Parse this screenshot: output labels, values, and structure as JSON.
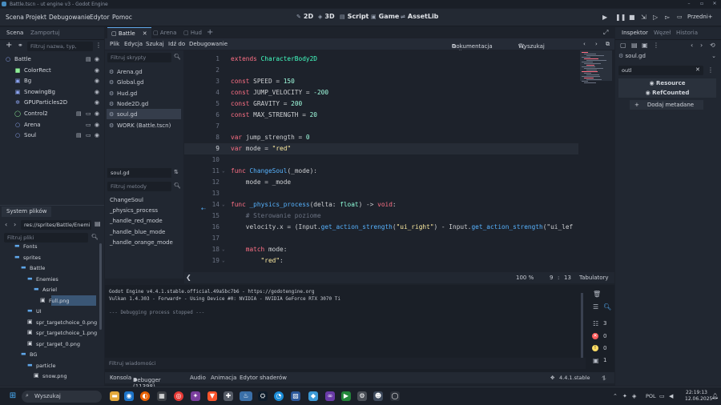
{
  "window": {
    "title": "Battle.tscn - ut engine v3 - Godot Engine"
  },
  "menubar": {
    "items": [
      "Scena",
      "Projekt",
      "Debugowanie",
      "Edytor",
      "Pomoc"
    ],
    "workspaces": [
      "2D",
      "3D",
      "Script",
      "Game",
      "AssetLib"
    ],
    "renderer": "Przedni+"
  },
  "scene_dock": {
    "tabs": [
      "Scena",
      "Zamportuj"
    ],
    "filter_placeholder": "Filtruj nazwa, typ,",
    "nodes": [
      {
        "label": "Battle",
        "icon": "node2d-icon",
        "color": "#8da5f3",
        "indent": 0
      },
      {
        "label": "ColorRect",
        "icon": "colorrect-icon",
        "color": "#8eef97",
        "indent": 1
      },
      {
        "label": "Bg",
        "icon": "sprite-icon",
        "color": "#8da5f3",
        "indent": 1
      },
      {
        "label": "SnowingBg",
        "icon": "sprite-icon",
        "color": "#8da5f3",
        "indent": 1
      },
      {
        "label": "GPUParticles2D",
        "icon": "particles-icon",
        "color": "#8da5f3",
        "indent": 1
      },
      {
        "label": "Control2",
        "icon": "control-icon",
        "color": "#8eef97",
        "indent": 1
      },
      {
        "label": "Arena",
        "icon": "node2d-icon",
        "color": "#8da5f3",
        "indent": 1
      },
      {
        "label": "Soul",
        "icon": "node2d-icon",
        "color": "#8da5f3",
        "indent": 1
      }
    ]
  },
  "filesystem": {
    "tab": "System plików",
    "path": "res://sprites/Battle/Enemi",
    "filter_placeholder": "Filtruj pliki",
    "rows": [
      {
        "label": "Fonts",
        "type": "folder",
        "indent": 1
      },
      {
        "label": "sprites",
        "type": "folder",
        "indent": 1
      },
      {
        "label": "Battle",
        "type": "folder",
        "indent": 2
      },
      {
        "label": "Enemies",
        "type": "folder",
        "indent": 3
      },
      {
        "label": "Asriel",
        "type": "folder",
        "indent": 4
      },
      {
        "label": "Full.png",
        "type": "image",
        "indent": 5,
        "selected": true
      },
      {
        "label": "UI",
        "type": "folder",
        "indent": 3
      },
      {
        "label": "spr_targetchoice_0.png",
        "type": "image",
        "indent": 3
      },
      {
        "label": "spr_targetchoice_1.png",
        "type": "image",
        "indent": 3
      },
      {
        "label": "spr_target_0.png",
        "type": "image",
        "indent": 3
      },
      {
        "label": "BG",
        "type": "folder",
        "indent": 2
      },
      {
        "label": "particle",
        "type": "folder",
        "indent": 3
      },
      {
        "label": "snow.png",
        "type": "image",
        "indent": 4
      }
    ]
  },
  "editor": {
    "scene_tabs": [
      "Battle",
      "Arena",
      "Hud"
    ],
    "script_menu": [
      "Plik",
      "Edycja",
      "Szukaj",
      "Idź do",
      "Debugowanie"
    ],
    "doc_link": "Dokumentacja online",
    "search_help": "Wyszukaj w pomocy",
    "script_filter": "Filtruj skrypty",
    "scripts": [
      "Arena.gd",
      "Global.gd",
      "Hud.gd",
      "Node2D.gd",
      "soul.gd",
      "WORK (Battle.tscn)"
    ],
    "selected_script": "soul.gd",
    "method_filter": "Filtruj metody",
    "methods": [
      "ChangeSoul",
      "_physics_process",
      "_handle_red_mode",
      "_handle_blue_mode",
      "_handle_orange_mode"
    ],
    "zoom": "100 %",
    "cursor_line": "9",
    "cursor_col": "13",
    "indent_mode": "Tabulatory"
  },
  "code_lines": [
    {
      "n": "1",
      "t": [
        [
          "kw",
          "extends "
        ],
        [
          "cls",
          "CharacterBody2D"
        ]
      ]
    },
    {
      "n": "2",
      "t": []
    },
    {
      "n": "3",
      "t": [
        [
          "kw",
          "const "
        ],
        [
          "plain",
          "SPEED = "
        ],
        [
          "num",
          "150"
        ]
      ]
    },
    {
      "n": "4",
      "t": [
        [
          "kw",
          "const "
        ],
        [
          "plain",
          "JUMP_VELOCITY = "
        ],
        [
          "num",
          "-200"
        ]
      ]
    },
    {
      "n": "5",
      "t": [
        [
          "kw",
          "const "
        ],
        [
          "plain",
          "GRAVITY = "
        ],
        [
          "num",
          "200"
        ]
      ]
    },
    {
      "n": "6",
      "t": [
        [
          "kw",
          "const "
        ],
        [
          "plain",
          "MAX_STRENGTH = "
        ],
        [
          "num",
          "20"
        ]
      ]
    },
    {
      "n": "7",
      "t": []
    },
    {
      "n": "8",
      "t": [
        [
          "kw",
          "var "
        ],
        [
          "plain",
          "jump_strength = "
        ],
        [
          "num",
          "0"
        ]
      ]
    },
    {
      "n": "9",
      "t": [
        [
          "kw",
          "var "
        ],
        [
          "plain",
          "mode = "
        ],
        [
          "str",
          "\"red\""
        ]
      ]
    },
    {
      "n": "10",
      "t": []
    },
    {
      "n": "11",
      "t": [
        [
          "kw",
          "func "
        ],
        [
          "fn",
          "ChangeSoul"
        ],
        [
          "plain",
          "(_mode):"
        ]
      ]
    },
    {
      "n": "12",
      "t": [
        [
          "plain",
          "    mode = _mode"
        ]
      ]
    },
    {
      "n": "13",
      "t": []
    },
    {
      "n": "14",
      "t": [
        [
          "kw",
          "func "
        ],
        [
          "fn",
          "_physics_process"
        ],
        [
          "plain",
          "(delta: "
        ],
        [
          "typ",
          "float"
        ],
        [
          "plain",
          ") -> "
        ],
        [
          "kw",
          "void"
        ],
        [
          "plain",
          ":"
        ]
      ]
    },
    {
      "n": "15",
      "t": [
        [
          "cm",
          "    # Sterowanie poziome"
        ]
      ]
    },
    {
      "n": "16",
      "t": [
        [
          "plain",
          "    velocity.x = (Input."
        ],
        [
          "fn",
          "get_action_strength"
        ],
        [
          "plain",
          "("
        ],
        [
          "str",
          "\"ui_right\""
        ],
        [
          "plain",
          ") - Input."
        ],
        [
          "fn",
          "get_action_strength"
        ],
        [
          "plain",
          "(\"ui_lef"
        ]
      ]
    },
    {
      "n": "17",
      "t": []
    },
    {
      "n": "18",
      "t": [
        [
          "kw",
          "    match "
        ],
        [
          "plain",
          "mode:"
        ]
      ]
    },
    {
      "n": "19",
      "t": [
        [
          "str",
          "        \"red\""
        ],
        [
          "plain",
          ":"
        ]
      ]
    }
  ],
  "output": {
    "lines": [
      "Godot Engine v4.4.1.stable.official.49a5bc7b6 - https://godotengine.org",
      "Vulkan 1.4.303 - Forward+ - Using Device #0: NVIDIA - NVIDIA GeForce RTX 3070 Ti",
      "",
      "--- Debugging process stopped ---"
    ],
    "filter_placeholder": "Filtruj wiadomości",
    "count_info": "3",
    "count_err": "0",
    "count_warn": "0",
    "count_other": "1"
  },
  "bottom_tabs": [
    "Konsola",
    "Debugger (11398)",
    "Audio",
    "Animacja",
    "Edytor shaderów"
  ],
  "version": "4.4.1.stable",
  "inspector": {
    "tabs": [
      "Inspektor",
      "Węzeł",
      "Historia"
    ],
    "file": "soul.gd",
    "search": "outl",
    "resource": "Resource",
    "refcounted": "RefCounted",
    "add_metadata": "Dodaj metadane"
  },
  "taskbar": {
    "search": "Wyszukaj",
    "lang": "POL",
    "time": "22:19:13",
    "date": "12.06.2025"
  }
}
